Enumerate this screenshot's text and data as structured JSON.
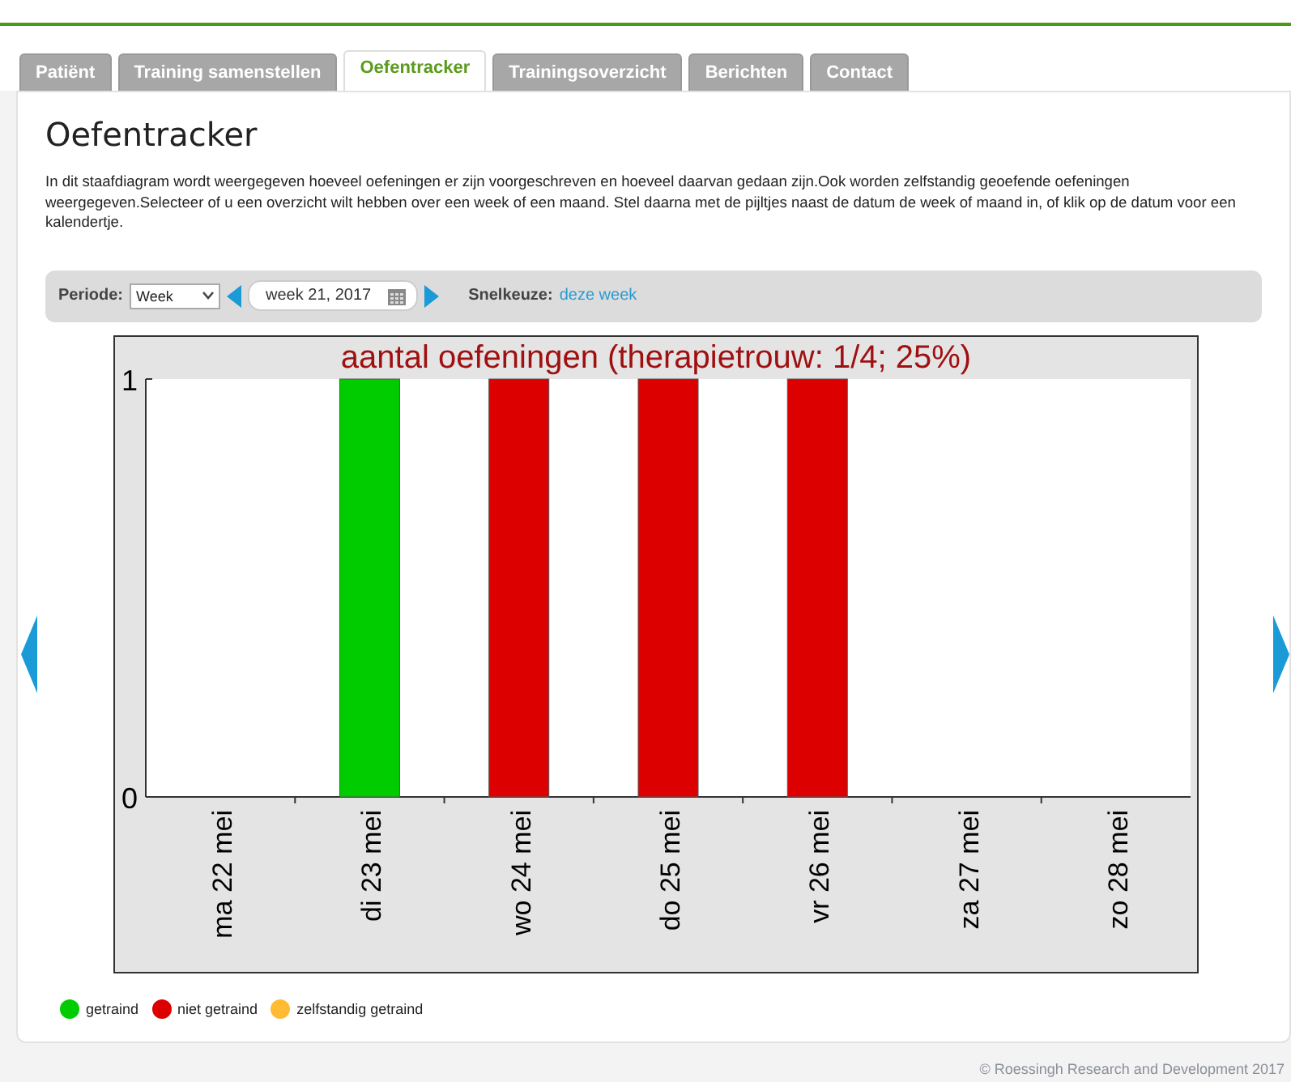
{
  "tabs": [
    {
      "label": "Patiënt",
      "selected": false
    },
    {
      "label": "Training samenstellen",
      "selected": false
    },
    {
      "label": "Oefentracker",
      "selected": true
    },
    {
      "label": "Trainingsoverzicht",
      "selected": false
    },
    {
      "label": "Berichten",
      "selected": false
    },
    {
      "label": "Contact",
      "selected": false
    }
  ],
  "heading": "Oefentracker",
  "description": "In dit staafdiagram wordt weergegeven hoeveel oefeningen er zijn voorgeschreven en hoeveel daarvan gedaan zijn.Ook worden zelfstandig geoefende oefeningen weergegeven.Selecteer of u een overzicht wilt hebben over een week of een maand. Stel daarna met de pijltjes naast de datum de week of maand in, of klik op de datum voor een kalendertje.",
  "toolbar": {
    "period_label": "Periode:",
    "period_value": "Week",
    "date_value": "week 21, 2017",
    "quick_label": "Snelkeuze:",
    "quick_link": "deze week"
  },
  "chart_data": {
    "type": "bar",
    "title": "aantal oefeningen (therapietrouw: 1/4; 25%)",
    "categories": [
      "ma 22 mei",
      "di 23 mei",
      "wo 24 mei",
      "do 25 mei",
      "vr 26 mei",
      "za 27 mei",
      "zo 28 mei"
    ],
    "stacked": true,
    "ylim": [
      0,
      1
    ],
    "yticks": [
      0,
      1
    ],
    "series": [
      {
        "name": "getraind",
        "color": "#00cc00",
        "values": [
          0,
          1,
          0,
          0,
          0,
          0,
          0
        ]
      },
      {
        "name": "niet getraind",
        "color": "#dd0000",
        "values": [
          0,
          0,
          1,
          1,
          1,
          0,
          0
        ]
      },
      {
        "name": "zelfstandig getraind",
        "color": "#ffbb33",
        "values": [
          0,
          0,
          0,
          0,
          0,
          0,
          0
        ]
      }
    ]
  },
  "footer": "© Roessingh Research and Development 2017"
}
